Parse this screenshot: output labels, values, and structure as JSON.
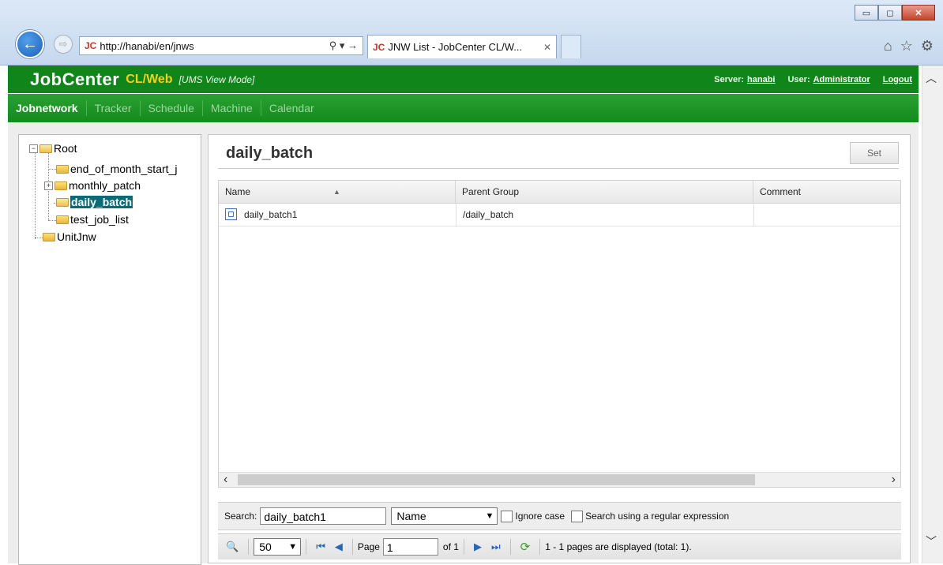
{
  "browser": {
    "address": "http://hanabi/en/jnws",
    "address_tools": "⚲ ▾ →",
    "tab_title": "JNW List - JobCenter CL/W...",
    "favicon_text": "JC"
  },
  "header": {
    "logo": "JobCenter",
    "logo_sub": "CL/Web",
    "mode": "[UMS View Mode]",
    "server_label": "Server:",
    "server": "hanabi",
    "user_label": "User:",
    "user": "Administrator",
    "logout": "Logout"
  },
  "nav": {
    "items": [
      "Jobnetwork",
      "Tracker",
      "Schedule",
      "Machine",
      "Calendar"
    ],
    "active": "Jobnetwork"
  },
  "tree": {
    "root": "Root",
    "children": [
      "end_of_month_start_j",
      "monthly_patch",
      "daily_batch",
      "test_job_list"
    ],
    "selected": "daily_batch",
    "other_root": "UnitJnw"
  },
  "panel": {
    "title": "daily_batch",
    "set_button": "Set",
    "columns": [
      "Name",
      "Parent Group",
      "Comment"
    ],
    "rows": [
      {
        "name": "daily_batch1",
        "parent_group": "/daily_batch",
        "comment": ""
      }
    ]
  },
  "search": {
    "label": "Search:",
    "value": "daily_batch1",
    "field": "Name",
    "ignore_case": "Ignore case",
    "regex": "Search using a regular expression"
  },
  "pager": {
    "page_size": "50",
    "page_label": "Page",
    "page_value": "1",
    "of_label": "of 1",
    "status": "1 - 1 pages are displayed (total: 1)."
  },
  "colors": {
    "header_green": "#10861a",
    "nav_green": "#2aa132",
    "selection": "#0a6b77",
    "logo_sub": "#f2d11c"
  }
}
